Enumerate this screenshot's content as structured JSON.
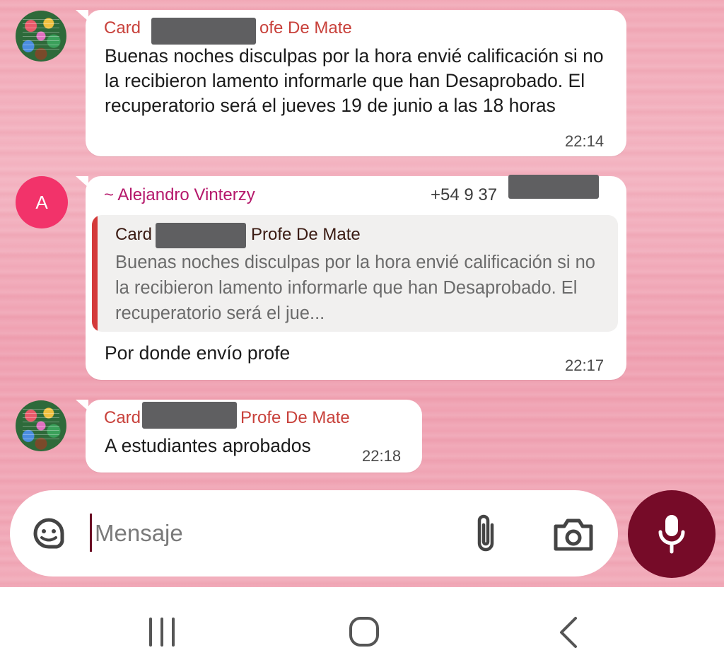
{
  "messages": [
    {
      "sender_prefix": "Card",
      "sender_suffix": "ofe De Mate",
      "text": "Buenas noches disculpas por la hora envié calificación si no la recibieron lamento informarle que han Desaprobado. El recuperatorio será el jueves 19 de junio a las 18 horas",
      "time": "22:14"
    },
    {
      "avatar_letter": "A",
      "sender": "~ Alejandro Vinterzy",
      "phone": "+54 9 37",
      "quote": {
        "sender_prefix": "Card",
        "sender_suffix": "Profe De Mate",
        "text": "Buenas noches disculpas por la hora envié calificación si no la recibieron lamento informarle que han Desaprobado. El recuperatorio será el jue..."
      },
      "text": "Por donde envío profe",
      "time": "22:17"
    },
    {
      "sender_prefix": "Card",
      "sender_suffix": "Profe De Mate",
      "text": "A estudiantes aprobados",
      "time": "22:18"
    }
  ],
  "composer": {
    "placeholder": "Mensaje",
    "icons": [
      "sticker-icon",
      "attach-icon",
      "camera-icon",
      "mic-icon"
    ]
  },
  "navbar": {
    "icons": [
      "recents-icon",
      "home-icon",
      "back-icon"
    ]
  },
  "colors": {
    "sender_red": "#c8413b",
    "sender_purple": "#b5186b",
    "mic_button": "#760b28",
    "avatar_pink": "#f2336a",
    "quote_bar": "#d43a3a"
  }
}
